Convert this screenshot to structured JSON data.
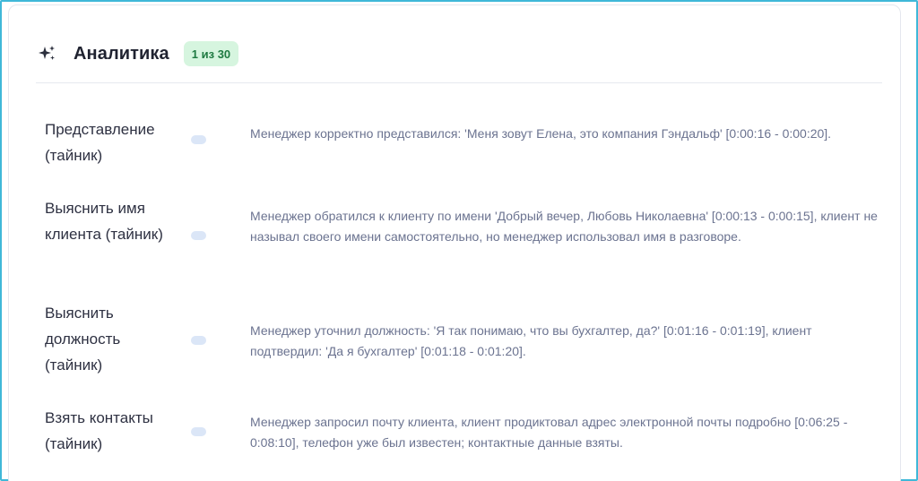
{
  "analytics": {
    "title": "Аналитика",
    "badge": "1 из 30",
    "icon": "sparkle-icon",
    "colors": {
      "frame_border": "#3fb8d8",
      "badge_bg": "#d6f5df",
      "badge_text": "#1f7a42",
      "toggle": "#dbe6f7",
      "description_text": "#6b7390"
    },
    "criteria": [
      {
        "label": "Представление (тайник)",
        "description": "Менеджер корректно представился: 'Меня зовут Елена, это компания Гэндальф' [0:00:16 - 0:00:20]."
      },
      {
        "label": "Выяснить имя клиента (тайник)",
        "description": "Менеджер обратился к клиенту по имени 'Добрый вечер, Любовь Николаевна' [0:00:13 - 0:00:15], клиент не называл своего имени самостоятельно, но менеджер использовал имя в разговоре."
      },
      {
        "label": "Выяснить должность (тайник)",
        "description": "Менеджер уточнил должность: 'Я так понимаю, что вы бухгалтер, да?' [0:01:16 - 0:01:19], клиент подтвердил: 'Да я бухгалтер' [0:01:18 - 0:01:20]."
      },
      {
        "label": "Взять контакты (тайник)",
        "description": "Менеджер запросил почту клиента, клиент продиктовал адрес электронной почты подробно [0:06:25 - 0:08:10], телефон уже был известен; контактные данные взяты."
      }
    ]
  }
}
